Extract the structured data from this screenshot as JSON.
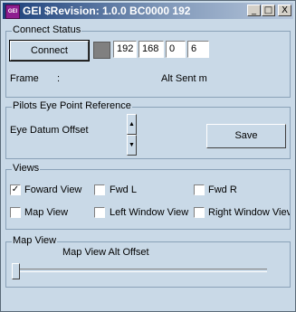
{
  "window": {
    "title": "GEI $Revision: 1.0.0 BC0000 192",
    "app_icon_text": "GEI",
    "controls": {
      "minimize": "_",
      "maximize": "□",
      "close": "X"
    }
  },
  "connect_status": {
    "group_label": "Connect Status",
    "connect_button": "Connect",
    "ip": [
      "192",
      "168",
      "0",
      "6"
    ],
    "frame_label": "Frame",
    "frame_sep": ":",
    "alt_sent_label": "Alt Sent m"
  },
  "pilot_eye": {
    "group_label": "Pilots Eye Point Reference",
    "datum_label": "Eye Datum Offset",
    "save_button": "Save"
  },
  "views": {
    "group_label": "Views",
    "items": [
      {
        "label": "Foward View",
        "checked": true
      },
      {
        "label": "Fwd L",
        "checked": false
      },
      {
        "label": "Fwd R",
        "checked": false
      },
      {
        "label": "Map View",
        "checked": false
      },
      {
        "label": "Left Window View",
        "checked": false
      },
      {
        "label": "Right Window Viev",
        "checked": false
      }
    ]
  },
  "map_view": {
    "group_label": "Map View",
    "slider_label": "Map View Alt Offset",
    "slider_value": 0
  },
  "colors": {
    "background": "#c9d9e7",
    "titlebar_start": "#1a3f7a",
    "titlebar_end": "#b7c7dc",
    "status_indicator": "#808080"
  }
}
